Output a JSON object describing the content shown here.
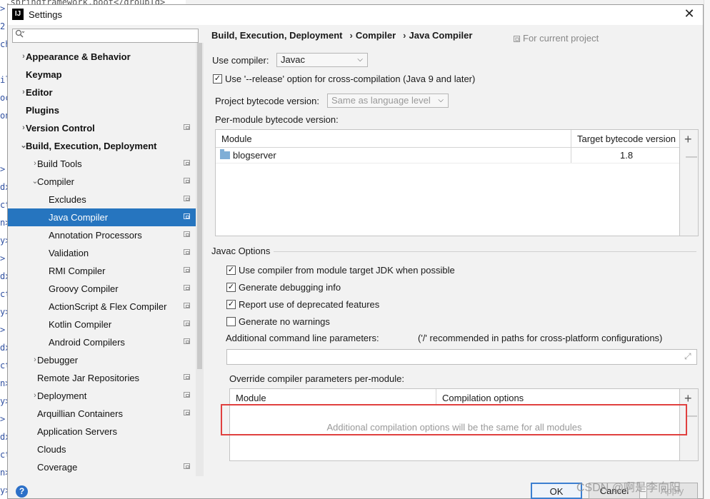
{
  "window": {
    "title": "Settings",
    "close_glyph": "✕",
    "app_icon_text": "IJ"
  },
  "background_code": {
    "top_text": "g.springframework.boot</groupId>"
  },
  "search": {
    "placeholder": "",
    "icon": "search-icon"
  },
  "sidebar": {
    "items": [
      {
        "label": "Appearance & Behavior",
        "bold": true,
        "arrow": "›",
        "indent": 0,
        "project": false
      },
      {
        "label": "Keymap",
        "bold": true,
        "arrow": "",
        "indent": 0,
        "project": false
      },
      {
        "label": "Editor",
        "bold": true,
        "arrow": "›",
        "indent": 0,
        "project": false
      },
      {
        "label": "Plugins",
        "bold": true,
        "arrow": "",
        "indent": 0,
        "project": false
      },
      {
        "label": "Version Control",
        "bold": true,
        "arrow": "›",
        "indent": 0,
        "project": true
      },
      {
        "label": "Build, Execution, Deployment",
        "bold": true,
        "arrow": "⌄",
        "indent": 0,
        "project": false
      },
      {
        "label": "Build Tools",
        "bold": false,
        "arrow": "›",
        "indent": 1,
        "project": true
      },
      {
        "label": "Compiler",
        "bold": false,
        "arrow": "⌄",
        "indent": 1,
        "project": true
      },
      {
        "label": "Excludes",
        "bold": false,
        "arrow": "",
        "indent": 2,
        "project": true
      },
      {
        "label": "Java Compiler",
        "bold": false,
        "arrow": "",
        "indent": 2,
        "project": true,
        "selected": true
      },
      {
        "label": "Annotation Processors",
        "bold": false,
        "arrow": "",
        "indent": 2,
        "project": true
      },
      {
        "label": "Validation",
        "bold": false,
        "arrow": "",
        "indent": 2,
        "project": true
      },
      {
        "label": "RMI Compiler",
        "bold": false,
        "arrow": "",
        "indent": 2,
        "project": true
      },
      {
        "label": "Groovy Compiler",
        "bold": false,
        "arrow": "",
        "indent": 2,
        "project": true
      },
      {
        "label": "ActionScript & Flex Compiler",
        "bold": false,
        "arrow": "",
        "indent": 2,
        "project": true
      },
      {
        "label": "Kotlin Compiler",
        "bold": false,
        "arrow": "",
        "indent": 2,
        "project": true
      },
      {
        "label": "Android Compilers",
        "bold": false,
        "arrow": "",
        "indent": 2,
        "project": true
      },
      {
        "label": "Debugger",
        "bold": false,
        "arrow": "›",
        "indent": 1,
        "project": false
      },
      {
        "label": "Remote Jar Repositories",
        "bold": false,
        "arrow": "",
        "indent": 1,
        "project": true
      },
      {
        "label": "Deployment",
        "bold": false,
        "arrow": "›",
        "indent": 1,
        "project": true
      },
      {
        "label": "Arquillian Containers",
        "bold": false,
        "arrow": "",
        "indent": 1,
        "project": true
      },
      {
        "label": "Application Servers",
        "bold": false,
        "arrow": "",
        "indent": 1,
        "project": false
      },
      {
        "label": "Clouds",
        "bold": false,
        "arrow": "",
        "indent": 1,
        "project": false
      },
      {
        "label": "Coverage",
        "bold": false,
        "arrow": "",
        "indent": 1,
        "project": true
      }
    ]
  },
  "breadcrumb": {
    "part1": "Build, Execution, Deployment",
    "part2": "Compiler",
    "part3": "Java Compiler",
    "separator": "›"
  },
  "for_current_project": "For current project",
  "use_compiler": {
    "label": "Use compiler:",
    "value": "Javac"
  },
  "release_option": {
    "label": "Use '--release' option for cross-compilation (Java 9 and later)",
    "checked": true
  },
  "project_bytecode": {
    "label": "Project bytecode version:",
    "value": "Same as language level"
  },
  "per_module_label": "Per-module bytecode version:",
  "module_table": {
    "col_module": "Module",
    "col_target": "Target bytecode version",
    "rows": [
      {
        "module": "blogserver",
        "target": "1.8"
      }
    ]
  },
  "javac_options": {
    "title": "Javac Options",
    "checkboxes": [
      {
        "label": "Use compiler from module target JDK when possible",
        "checked": true
      },
      {
        "label": "Generate debugging info",
        "checked": true
      },
      {
        "label": "Report use of deprecated features",
        "checked": true
      },
      {
        "label": "Generate no warnings",
        "checked": false
      }
    ],
    "additional_label": "Additional command line parameters:",
    "additional_hint": "('/' recommended in paths for cross-platform configurations)",
    "additional_value": ""
  },
  "override": {
    "label": "Override compiler parameters per-module:",
    "col_module": "Module",
    "col_options": "Compilation options",
    "empty_text": "Additional compilation options will be the same for all modules"
  },
  "buttons": {
    "ok": "OK",
    "cancel": "Cancel",
    "apply": "Apply",
    "help": "?"
  },
  "watermark": "CSDN @啊是李向阳",
  "colors": {
    "selection": "#2675bf",
    "highlight_box": "#e0403f"
  }
}
